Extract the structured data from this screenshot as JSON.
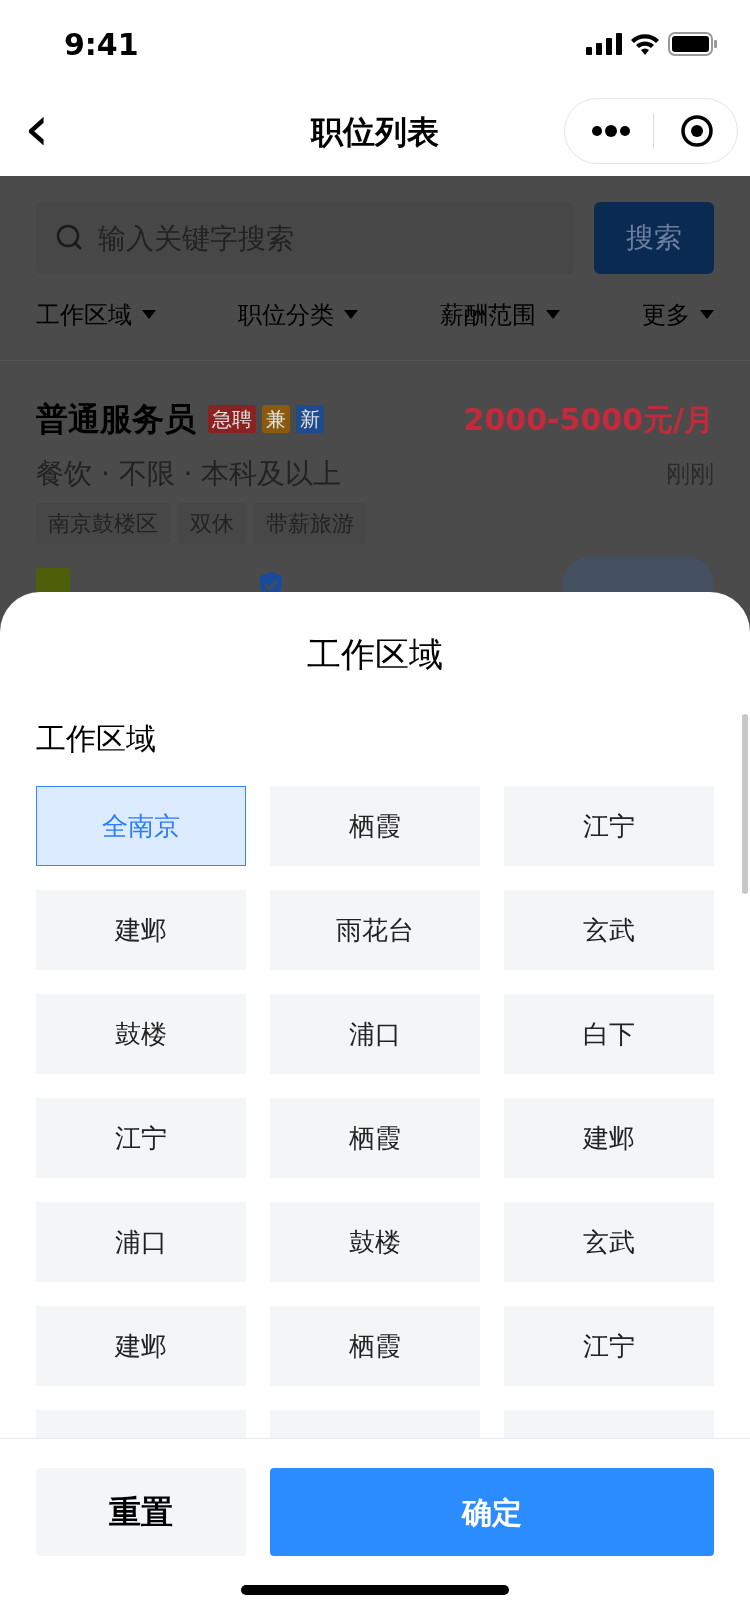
{
  "status_bar": {
    "time": "9:41"
  },
  "nav": {
    "title": "职位列表",
    "back": "‹"
  },
  "search": {
    "placeholder": "输入关键字搜索",
    "button": "搜索"
  },
  "filters": [
    {
      "label": "工作区域"
    },
    {
      "label": "职位分类"
    },
    {
      "label": "薪酬范围"
    },
    {
      "label": "更多"
    }
  ],
  "job": {
    "title": "普通服务员",
    "badges": [
      {
        "label": "急聘",
        "color": "#8a2222"
      },
      {
        "label": "兼",
        "color": "#8a5a0e"
      },
      {
        "label": "新",
        "color": "#1e4a8e"
      }
    ],
    "salary": "2000-5000元/月",
    "meta": "餐饮 · 不限 · 本科及以上",
    "time": "刚刚",
    "tags": [
      "南京鼓楼区",
      "双休",
      "带薪旅游"
    ]
  },
  "sheet": {
    "title": "工作区域",
    "section": "工作区域",
    "options": [
      {
        "label": "全南京",
        "selected": true
      },
      {
        "label": "栖霞",
        "selected": false
      },
      {
        "label": "江宁",
        "selected": false
      },
      {
        "label": "建邺",
        "selected": false
      },
      {
        "label": "雨花台",
        "selected": false
      },
      {
        "label": "玄武",
        "selected": false
      },
      {
        "label": "鼓楼",
        "selected": false
      },
      {
        "label": "浦口",
        "selected": false
      },
      {
        "label": "白下",
        "selected": false
      },
      {
        "label": "江宁",
        "selected": false
      },
      {
        "label": "栖霞",
        "selected": false
      },
      {
        "label": "建邺",
        "selected": false
      },
      {
        "label": "浦口",
        "selected": false
      },
      {
        "label": "鼓楼",
        "selected": false
      },
      {
        "label": "玄武",
        "selected": false
      },
      {
        "label": "建邺",
        "selected": false
      },
      {
        "label": "栖霞",
        "selected": false
      },
      {
        "label": "江宁",
        "selected": false
      }
    ],
    "reset": "重置",
    "confirm": "确定"
  }
}
